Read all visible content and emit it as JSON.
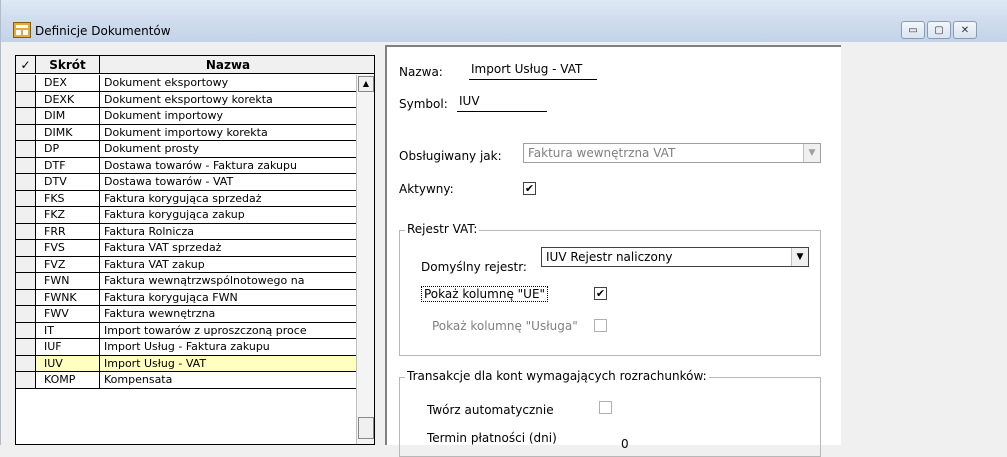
{
  "window": {
    "title": "Definicje Dokumentów",
    "buttons": {
      "minimize": "▭",
      "maximize": "▢",
      "close": "✕"
    }
  },
  "grid": {
    "headers": {
      "check": "✓",
      "code": "Skrót",
      "name": "Nazwa"
    },
    "rows": [
      {
        "code": "DEX",
        "name": "Dokument eksportowy"
      },
      {
        "code": "DEXK",
        "name": "Dokument eksportowy korekta"
      },
      {
        "code": "DIM",
        "name": "Dokument importowy"
      },
      {
        "code": "DIMK",
        "name": "Dokument importowy korekta"
      },
      {
        "code": "DP",
        "name": "Dokument prosty"
      },
      {
        "code": "DTF",
        "name": "Dostawa towarów - Faktura zakupu"
      },
      {
        "code": "DTV",
        "name": "Dostawa towarów - VAT"
      },
      {
        "code": "FKS",
        "name": "Faktura korygująca sprzedaż"
      },
      {
        "code": "FKZ",
        "name": "Faktura korygująca zakup"
      },
      {
        "code": "FRR",
        "name": "Faktura Rolnicza"
      },
      {
        "code": "FVS",
        "name": "Faktura VAT sprzedaż"
      },
      {
        "code": "FVZ",
        "name": "Faktura VAT zakup"
      },
      {
        "code": "FWN",
        "name": "Faktura wewnątrzwspólnotowego na"
      },
      {
        "code": "FWNK",
        "name": "Faktura korygująca FWN"
      },
      {
        "code": "FWV",
        "name": "Faktura wewnętrzna"
      },
      {
        "code": "IT",
        "name": "Import towarów z uproszczoną proce"
      },
      {
        "code": "IUF",
        "name": "Import Usług - Faktura zakupu"
      },
      {
        "code": "IUV",
        "name": "Import Usług - VAT"
      },
      {
        "code": "KOMP",
        "name": "Kompensata"
      }
    ],
    "selected_index": 17
  },
  "form": {
    "name_label": "Nazwa:",
    "name_value": "Import Usług - VAT",
    "symbol_label": "Symbol:",
    "symbol_value": "IUV",
    "handled_as_label": "Obsługiwany jak:",
    "handled_as_value": "Faktura wewnętrzna VAT",
    "active_label": "Aktywny:",
    "active_checked": true,
    "vat_register": {
      "title": "Rejestr VAT:",
      "default_register_label": "Domyślny rejestr:",
      "default_register_value": "IUV Rejestr naliczony",
      "show_ue_label": "Pokaż kolumnę \"UE\"",
      "show_ue_checked": true,
      "show_service_label": "Pokaż kolumnę \"Usługa\"",
      "show_service_checked": false
    },
    "transactions": {
      "title": "Transakcje dla kont wymagających rozrachunków:",
      "auto_create_label": "Twórz automatycznie",
      "auto_create_checked": false,
      "payment_term_label": "Termin płatności (dni)",
      "payment_term_value": "0"
    }
  }
}
